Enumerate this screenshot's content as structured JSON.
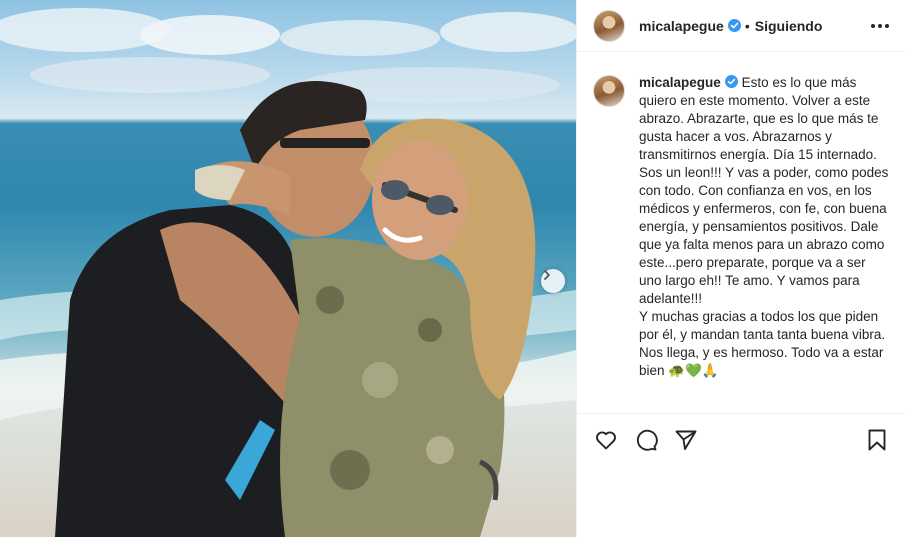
{
  "post": {
    "username": "micalapegue",
    "follow_status": "Siguiendo",
    "caption": "Esto es lo que más quiero en este momento. Volver a este abrazo. Abrazarte, que es lo que más te gusta hacer a vos. Abrazarnos y transmitirnos energía. Día 15 internado. Sos un leon!!! Y vas a poder, como podes con todo. Con confianza en vos, en los médicos y enfermeros, con fe, con buena energía, y pensamientos positivos. Dale que ya falta menos para un abrazo como este...pero preparate, porque va a ser uno largo eh!! Te amo. Y vamos para adelante!!!\nY muchas gracias a todos los que piden por él, y mandan tanta tanta buena vibra. Nos llega, y es hermoso. Todo va a estar bien 🐢💚🙏"
  },
  "colors": {
    "verified_badge": "#3897f0",
    "text": "#262626",
    "divider": "#efefef"
  },
  "icons": {
    "verified": "verified-badge-icon",
    "more": "more-options-icon",
    "next": "chevron-right-icon",
    "like": "heart-icon",
    "comment": "comment-icon",
    "share": "paper-plane-icon",
    "save": "bookmark-icon"
  }
}
